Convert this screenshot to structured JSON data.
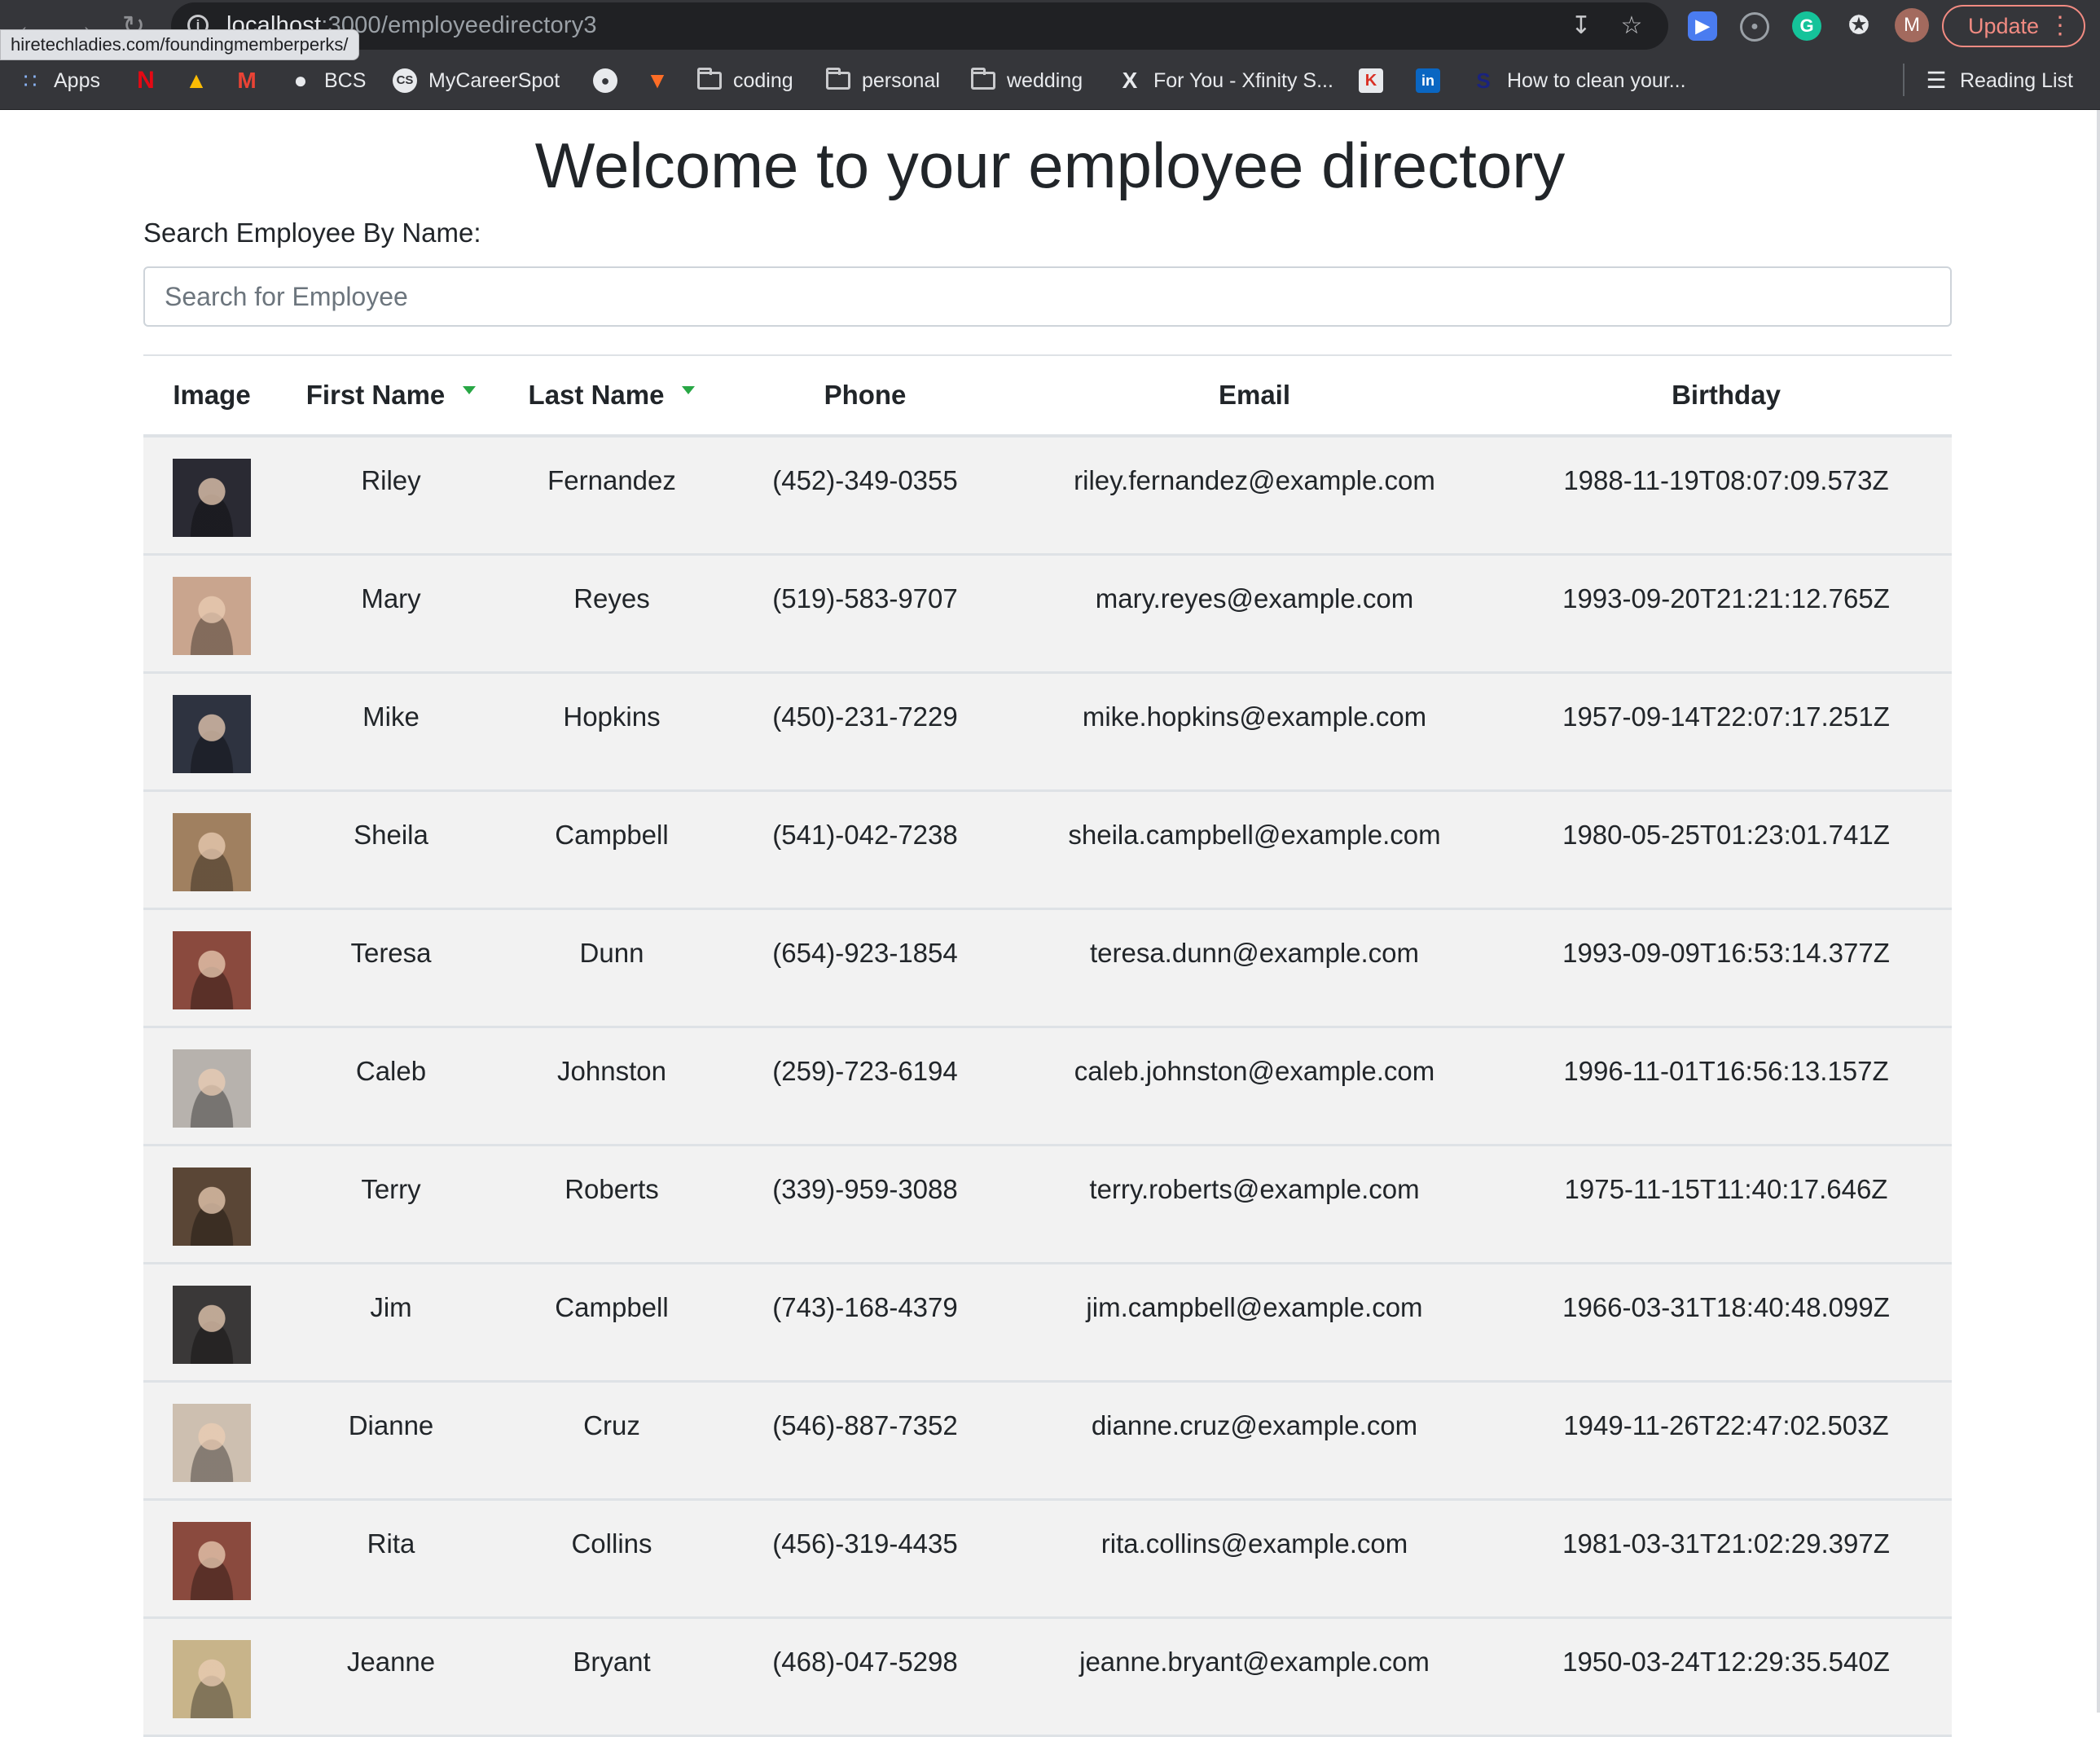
{
  "browser": {
    "url_host": "localhost",
    "url_rest": ":3000/employeedirectory3",
    "status_url": "hiretechladies.com/foundingmemberperks/",
    "profile_initial": "M",
    "update_label": "Update",
    "bookmarks": [
      {
        "label": "Apps",
        "icon": "apps-grid-icon"
      },
      {
        "label": "",
        "icon": "netflix-icon"
      },
      {
        "label": "",
        "icon": "google-drive-icon"
      },
      {
        "label": "",
        "icon": "gmail-icon"
      },
      {
        "label": "BCS",
        "icon": "globe-icon"
      },
      {
        "label": "MyCareerSpot",
        "icon": "careerspot-icon"
      },
      {
        "label": "",
        "icon": "github-icon"
      },
      {
        "label": "",
        "icon": "gitlab-icon"
      },
      {
        "label": "coding",
        "icon": "folder-icon"
      },
      {
        "label": "personal",
        "icon": "folder-icon"
      },
      {
        "label": "wedding",
        "icon": "folder-icon"
      },
      {
        "label": "For You - Xfinity S...",
        "icon": "xfinity-icon"
      },
      {
        "label": "",
        "icon": "app-icon"
      },
      {
        "label": "",
        "icon": "linkedin-icon"
      },
      {
        "label": "How to clean your...",
        "icon": "site-icon"
      }
    ],
    "reading_list_label": "Reading List"
  },
  "page": {
    "title": "Welcome to your employee directory",
    "search_label": "Search Employee By Name:",
    "search_placeholder": "Search for Employee",
    "search_value": ""
  },
  "table": {
    "headers": [
      "Image",
      "First Name",
      "Last Name",
      "Phone",
      "Email",
      "Birthday"
    ],
    "sortable_indicator_color": "#28a745",
    "rows": [
      {
        "first": "Riley",
        "last": "Fernandez",
        "phone": "(452)-349-0355",
        "email": "riley.fernandez@example.com",
        "birthday": "1988-11-19T08:07:09.573Z",
        "avatar_color": "#2a2a33"
      },
      {
        "first": "Mary",
        "last": "Reyes",
        "phone": "(519)-583-9707",
        "email": "mary.reyes@example.com",
        "birthday": "1993-09-20T21:21:12.765Z",
        "avatar_color": "#c9a58e"
      },
      {
        "first": "Mike",
        "last": "Hopkins",
        "phone": "(450)-231-7229",
        "email": "mike.hopkins@example.com",
        "birthday": "1957-09-14T22:07:17.251Z",
        "avatar_color": "#2e3340"
      },
      {
        "first": "Sheila",
        "last": "Campbell",
        "phone": "(541)-042-7238",
        "email": "sheila.campbell@example.com",
        "birthday": "1980-05-25T01:23:01.741Z",
        "avatar_color": "#a08060"
      },
      {
        "first": "Teresa",
        "last": "Dunn",
        "phone": "(654)-923-1854",
        "email": "teresa.dunn@example.com",
        "birthday": "1993-09-09T16:53:14.377Z",
        "avatar_color": "#8a4a3e"
      },
      {
        "first": "Caleb",
        "last": "Johnston",
        "phone": "(259)-723-6194",
        "email": "caleb.johnston@example.com",
        "birthday": "1996-11-01T16:56:13.157Z",
        "avatar_color": "#b7b2ad"
      },
      {
        "first": "Terry",
        "last": "Roberts",
        "phone": "(339)-959-3088",
        "email": "terry.roberts@example.com",
        "birthday": "1975-11-15T11:40:17.646Z",
        "avatar_color": "#5a4636"
      },
      {
        "first": "Jim",
        "last": "Campbell",
        "phone": "(743)-168-4379",
        "email": "jim.campbell@example.com",
        "birthday": "1966-03-31T18:40:48.099Z",
        "avatar_color": "#3a3838"
      },
      {
        "first": "Dianne",
        "last": "Cruz",
        "phone": "(546)-887-7352",
        "email": "dianne.cruz@example.com",
        "birthday": "1949-11-26T22:47:02.503Z",
        "avatar_color": "#cdbfb0"
      },
      {
        "first": "Rita",
        "last": "Collins",
        "phone": "(456)-319-4435",
        "email": "rita.collins@example.com",
        "birthday": "1981-03-31T21:02:29.397Z",
        "avatar_color": "#8a4a3e"
      },
      {
        "first": "Jeanne",
        "last": "Bryant",
        "phone": "(468)-047-5298",
        "email": "jeanne.bryant@example.com",
        "birthday": "1950-03-24T12:29:35.540Z",
        "avatar_color": "#c8b48a"
      }
    ]
  }
}
